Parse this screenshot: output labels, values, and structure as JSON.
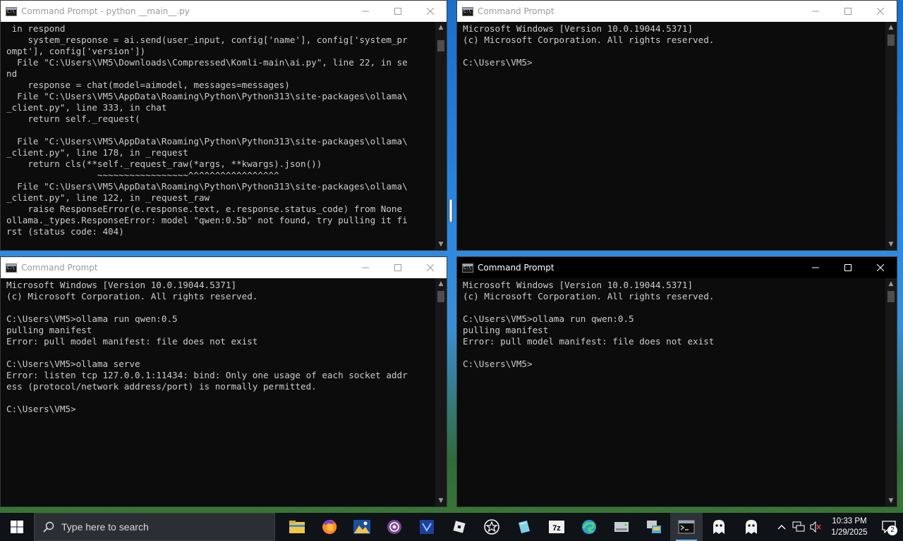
{
  "windows": [
    {
      "title": "Command Prompt - python  __main__.py",
      "lines": [
        " in respond",
        "    system_response = ai.send(user_input, config['name'], config['system_pr",
        "ompt'], config['version'])",
        "  File \"C:\\Users\\VM5\\Downloads\\Compressed\\Komli-main\\ai.py\", line 22, in se",
        "nd",
        "    response = chat(model=aimodel, messages=messages)",
        "  File \"C:\\Users\\VM5\\AppData\\Roaming\\Python\\Python313\\site-packages\\ollama\\",
        "_client.py\", line 333, in chat",
        "    return self._request(",
        "",
        "  File \"C:\\Users\\VM5\\AppData\\Roaming\\Python\\Python313\\site-packages\\ollama\\",
        "_client.py\", line 178, in _request",
        "    return cls(**self._request_raw(*args, **kwargs).json())",
        "                 ~~~~~~~~~~~~~~~~~^^^^^^^^^^^^^^^^^",
        "  File \"C:\\Users\\VM5\\AppData\\Roaming\\Python\\Python313\\site-packages\\ollama\\",
        "_client.py\", line 122, in _request_raw",
        "    raise ResponseError(e.response.text, e.response.status_code) from None",
        "ollama._types.ResponseError: model \"qwen:0.5b\" not found, try pulling it fi",
        "rst (status code: 404)"
      ]
    },
    {
      "title": "Command Prompt",
      "lines": [
        "Microsoft Windows [Version 10.0.19044.5371]",
        "(c) Microsoft Corporation. All rights reserved.",
        "",
        "C:\\Users\\VM5>"
      ]
    },
    {
      "title": "Command Prompt",
      "lines": [
        "Microsoft Windows [Version 10.0.19044.5371]",
        "(c) Microsoft Corporation. All rights reserved.",
        "",
        "C:\\Users\\VM5>ollama run qwen:0.5",
        "pulling manifest",
        "Error: pull model manifest: file does not exist",
        "",
        "C:\\Users\\VM5>ollama serve",
        "Error: listen tcp 127.0.0.1:11434: bind: Only one usage of each socket addr",
        "ess (protocol/network address/port) is normally permitted.",
        "",
        "C:\\Users\\VM5>"
      ]
    },
    {
      "title": "Command Prompt",
      "lines": [
        "Microsoft Windows [Version 10.0.19044.5371]",
        "(c) Microsoft Corporation. All rights reserved.",
        "",
        "C:\\Users\\VM5>ollama run qwen:0.5",
        "pulling manifest",
        "Error: pull model manifest: file does not exist",
        "",
        "C:\\Users\\VM5>"
      ]
    }
  ],
  "taskbar": {
    "search_placeholder": "Type here to search",
    "apps": [
      "file-explorer-icon",
      "firefox-icon",
      "image-viewer-icon",
      "tor-browser-icon",
      "visual-studio-icon",
      "roblox-icon",
      "chess-icon",
      "notes-icon",
      "7zip-icon",
      "edge-icon",
      "disk-icon",
      "network-share-icon",
      "command-prompt-icon",
      "ghost-app-icon",
      "ghost-app-2-icon"
    ],
    "time": "10:33 PM",
    "date": "1/29/2025",
    "notification_count": "2"
  },
  "colors": {
    "console_bg": "#0c0c0c",
    "console_text": "#cccccc",
    "taskbar_bg": "#0f1317",
    "accent": "#76b9ed"
  }
}
